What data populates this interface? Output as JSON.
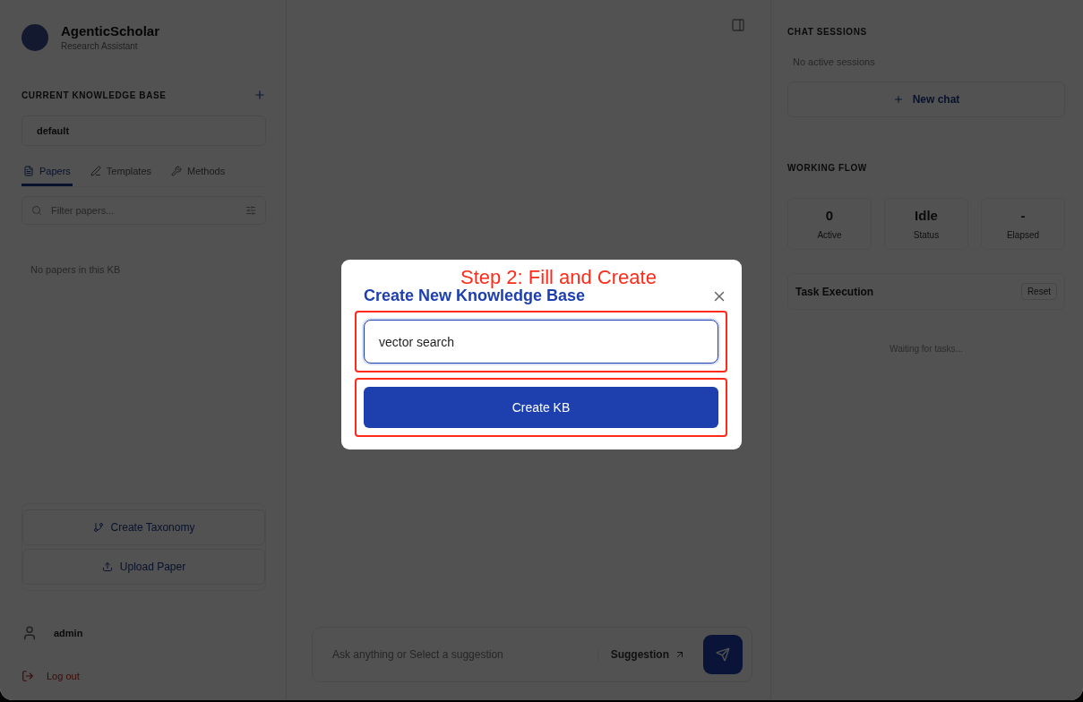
{
  "app": {
    "name": "AgenticScholar",
    "subtitle": "Research Assistant"
  },
  "sidebar": {
    "kb_heading": "CURRENT KNOWLEDGE BASE",
    "kb_value": "default",
    "tabs": [
      {
        "label": "Papers",
        "selected": true
      },
      {
        "label": "Templates",
        "selected": false
      },
      {
        "label": "Methods",
        "selected": false
      }
    ],
    "filter": {
      "placeholder": "Filter papers..."
    },
    "empty": "No papers in this KB",
    "actions": [
      "Create Taxonomy",
      "Upload Paper"
    ],
    "user": "admin",
    "logout": "Log out"
  },
  "chat": {
    "placeholder": "Ask anything or Select a suggestion",
    "suggestion": "Suggestion"
  },
  "right": {
    "sessions_heading": "CHAT SESSIONS",
    "sessions_empty": "No active sessions",
    "new_chat": "New chat",
    "flow_heading": "WORKING FLOW",
    "stats": [
      {
        "value": "0",
        "label": "Active"
      },
      {
        "value": "Idle",
        "label": "Status"
      },
      {
        "value": "-",
        "label": "Elapsed"
      }
    ],
    "task_title": "Task Execution",
    "reset": "Reset",
    "waiting": "Waiting for tasks..."
  },
  "modal": {
    "annotation": "Step 2: Fill and Create",
    "title": "Create New Knowledge Base",
    "input_value": "vector search",
    "submit": "Create KB"
  }
}
